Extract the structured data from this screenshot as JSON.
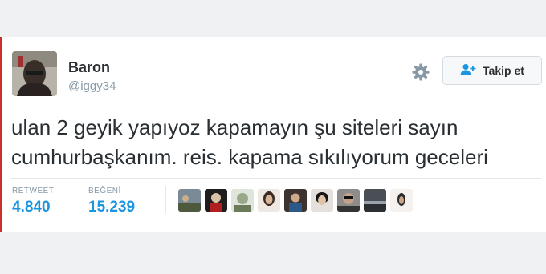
{
  "tweet": {
    "author_name": "Baron",
    "handle": "@iggy34",
    "text_line1": "ulan 2 geyik yapıyoz kapamayın şu siteleri sayın",
    "text_line2": "cumhurbaşkanım. reis. kapama sıkılıyorum geceleri"
  },
  "actions": {
    "follow_label": "Takip et",
    "settings_icon": "gear-icon",
    "follow_icon": "add-user-icon"
  },
  "stats": {
    "retweet_label": "RETWEET",
    "retweet_count": "4.840",
    "like_label": "BEĞENİ",
    "like_count": "15.239"
  },
  "colors": {
    "accent": "#1b95e0",
    "text": "#292f33",
    "muted": "#8899a6"
  },
  "likers": [
    {
      "icon": "liker-avatar-1"
    },
    {
      "icon": "liker-avatar-2"
    },
    {
      "icon": "liker-avatar-3"
    },
    {
      "icon": "liker-avatar-4"
    },
    {
      "icon": "liker-avatar-5"
    },
    {
      "icon": "liker-avatar-6"
    },
    {
      "icon": "liker-avatar-7"
    },
    {
      "icon": "liker-avatar-8"
    },
    {
      "icon": "liker-avatar-9"
    }
  ]
}
